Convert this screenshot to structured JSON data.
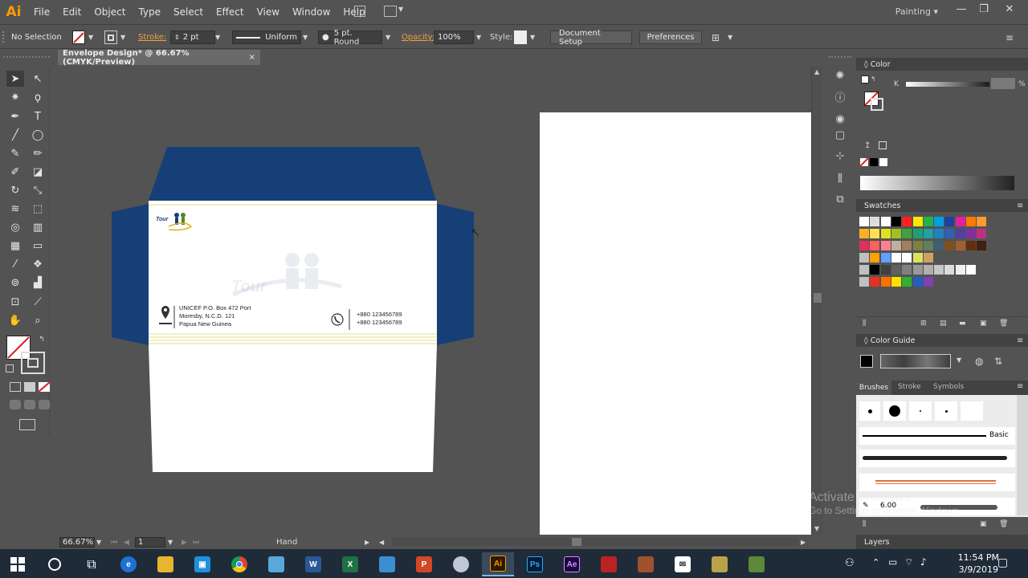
{
  "app": {
    "logo": "Ai",
    "workspace": "Painting"
  },
  "menu": [
    "File",
    "Edit",
    "Object",
    "Type",
    "Select",
    "Effect",
    "View",
    "Window",
    "Help"
  ],
  "control": {
    "selection": "No Selection",
    "stroke_label": "Stroke:",
    "stroke_weight": "2 pt",
    "stroke_profile": "Uniform",
    "brush": "5 pt. Round",
    "opacity_label": "Opacity:",
    "opacity_value": "100%",
    "style_label": "Style:",
    "document_setup": "Document Setup",
    "preferences": "Preferences"
  },
  "document_tab": {
    "title": "Envelope Design* @ 66.67% (CMYK/Preview)",
    "close": "×"
  },
  "envelope": {
    "address_line1": "UNICEF P.O. Box 472 Port",
    "address_line2": "Moresby, N.C.D. 121",
    "address_line3": "Papua New Guinea",
    "phone1": "+880 123456789",
    "phone2": "+880 123456789",
    "logo_text": "Tour",
    "watermark_text": "Tour"
  },
  "status": {
    "zoom": "66.67%",
    "page": "1",
    "tool": "Hand"
  },
  "panels": {
    "color": {
      "title": "Color",
      "channel": "K",
      "unit": "%"
    },
    "swatches": {
      "title": "Swatches"
    },
    "color_guide": {
      "title": "Color Guide"
    },
    "brush_tabs": [
      "Brushes",
      "Stroke",
      "Symbols"
    ],
    "brush_basic": "Basic",
    "brush_size": "6.00",
    "layers": {
      "title": "Layers"
    }
  },
  "activate": {
    "line1": "Activate Windows",
    "line2": "Go to Settings to activate Windows."
  },
  "taskbar": {
    "time": "11:54 PM",
    "date": "3/9/2019"
  },
  "colors": {
    "envelope_blue": "#163f78",
    "accent_yellow": "#e7e89b",
    "ui_gray": "#535353"
  }
}
